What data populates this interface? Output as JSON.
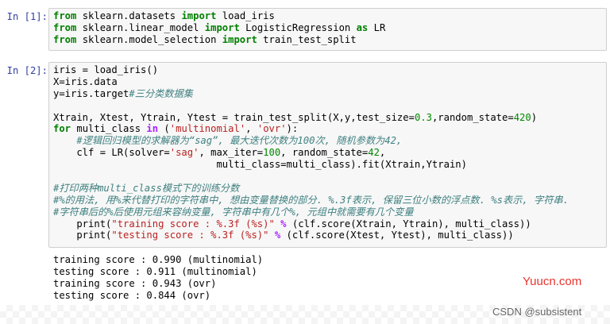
{
  "cells": [
    {
      "prompt": "In [1]:",
      "lines": [
        [
          [
            "kw",
            "from"
          ],
          [
            "t",
            " sklearn.datasets "
          ],
          [
            "kw",
            "import"
          ],
          [
            "t",
            " load_iris"
          ]
        ],
        [
          [
            "kw",
            "from"
          ],
          [
            "t",
            " sklearn.linear_model "
          ],
          [
            "kw",
            "import"
          ],
          [
            "t",
            " LogisticRegression "
          ],
          [
            "kw",
            "as"
          ],
          [
            "t",
            " LR"
          ]
        ],
        [
          [
            "kw",
            "from"
          ],
          [
            "t",
            " sklearn.model_selection "
          ],
          [
            "kw",
            "import"
          ],
          [
            "t",
            " train_test_split"
          ]
        ]
      ]
    },
    {
      "prompt": "In [2]:",
      "lines": [
        [
          [
            "t",
            "iris = load_iris()"
          ]
        ],
        [
          [
            "t",
            "X=iris.data"
          ]
        ],
        [
          [
            "t",
            "y=iris.target"
          ],
          [
            "cm",
            "#三分类数据集"
          ]
        ],
        [
          [
            "t",
            ""
          ]
        ],
        [
          [
            "t",
            "Xtrain, Xtest, Ytrain, Ytest = train_test_split(X,y,test_size="
          ],
          [
            "num",
            "0.3"
          ],
          [
            "t",
            ",random_state="
          ],
          [
            "num",
            "420"
          ],
          [
            "t",
            ")"
          ]
        ],
        [
          [
            "kw",
            "for"
          ],
          [
            "t",
            " multi_class "
          ],
          [
            "op",
            "in"
          ],
          [
            "t",
            " ("
          ],
          [
            "str",
            "'multinomial'"
          ],
          [
            "t",
            ", "
          ],
          [
            "str",
            "'ovr'"
          ],
          [
            "t",
            "):"
          ]
        ],
        [
          [
            "t",
            "    "
          ],
          [
            "cm",
            "#逻辑回归模型的求解器为“sag”, 最大迭代次数为100次, 随机参数为42,"
          ]
        ],
        [
          [
            "t",
            "    clf = LR(solver="
          ],
          [
            "str",
            "'sag'"
          ],
          [
            "t",
            ", max_iter="
          ],
          [
            "num",
            "100"
          ],
          [
            "t",
            ", random_state="
          ],
          [
            "num",
            "42"
          ],
          [
            "t",
            ","
          ]
        ],
        [
          [
            "t",
            "                            multi_class=multi_class).fit(Xtrain,Ytrain)"
          ]
        ],
        [
          [
            "t",
            ""
          ]
        ],
        [
          [
            "cm",
            "#打印两种multi_class模式下的训练分数"
          ]
        ],
        [
          [
            "cm",
            "#%的用法, 用%来代替打印的字符串中, 想由变量替换的部分. %.3f表示, 保留三位小数的浮点数. %s表示, 字符串."
          ]
        ],
        [
          [
            "cm",
            "#字符串后的%后使用元组来容纳变量, 字符串中有几个%, 元组中就需要有几个变量"
          ]
        ],
        [
          [
            "t",
            "    print("
          ],
          [
            "str",
            "\"training score : %.3f (%s)\""
          ],
          [
            "t",
            " "
          ],
          [
            "op",
            "%"
          ],
          [
            "t",
            " (clf.score(Xtrain, Ytrain), multi_class))"
          ]
        ],
        [
          [
            "t",
            "    print("
          ],
          [
            "str",
            "\"testing score : %.3f (%s)\""
          ],
          [
            "t",
            " "
          ],
          [
            "op",
            "%"
          ],
          [
            "t",
            " (clf.score(Xtest, Ytest), multi_class))"
          ]
        ]
      ]
    }
  ],
  "output": [
    "training score : 0.990 (multinomial)",
    "testing score : 0.911 (multinomial)",
    "training score : 0.943 (ovr)",
    "testing score : 0.844 (ovr)"
  ],
  "watermarks": {
    "site": "Yuucn.com",
    "author": "CSDN @subsistent"
  }
}
